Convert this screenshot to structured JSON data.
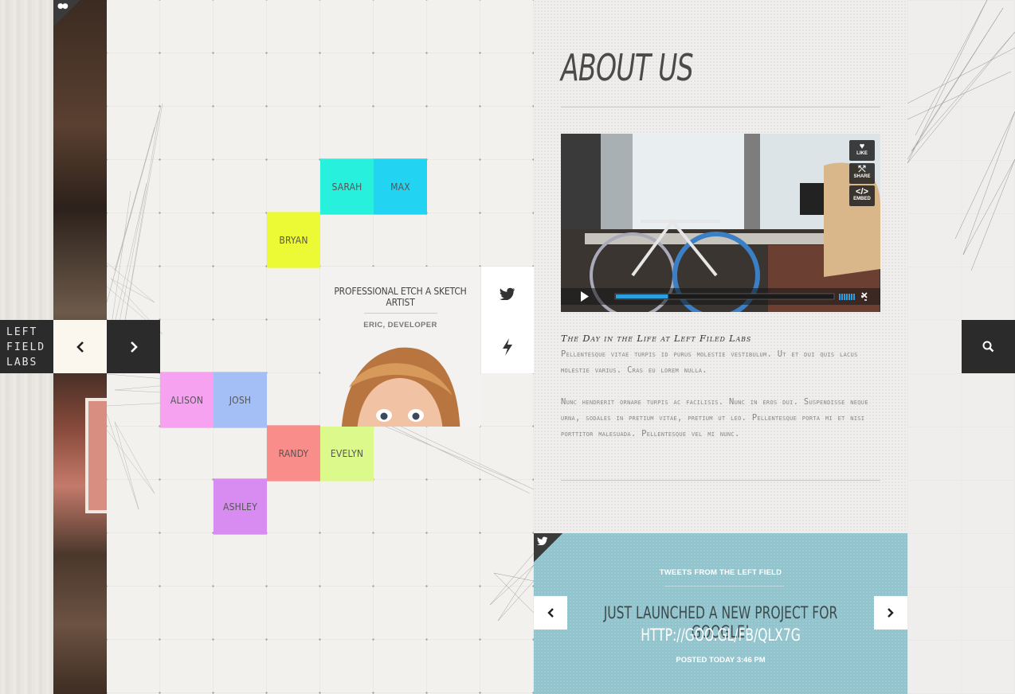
{
  "brand": {
    "lines": [
      "LEFT",
      "FIELD",
      "LABS"
    ]
  },
  "nav": {
    "prev_icon": "chevron-left-icon",
    "next_icon": "chevron-right-icon"
  },
  "team": [
    {
      "name": "SARAH",
      "color": "#27f0dd"
    },
    {
      "name": "MAX",
      "color": "#22d3f2"
    },
    {
      "name": "BRYAN",
      "color": "#ecfa36"
    },
    {
      "name": "ALISON",
      "color": "#f6a2f1"
    },
    {
      "name": "JOSH",
      "color": "#a4bff6"
    },
    {
      "name": "RANDY",
      "color": "#f98d8a"
    },
    {
      "name": "EVELYN",
      "color": "#dcfa8b"
    },
    {
      "name": "ASHLEY",
      "color": "#d88cf2"
    }
  ],
  "profile": {
    "title": "PROFESSIONAL ETCH A SKETCH ARTIST",
    "role": "ERIC, DEVELOPER"
  },
  "side_buttons": {
    "twitter_icon": "twitter-bird-icon",
    "bolt_icon": "lightning-icon"
  },
  "about": {
    "heading": "ABOUT US",
    "video_buttons": {
      "like": "LIKE",
      "share": "SHARE",
      "embed": "EMBED"
    },
    "post_title": "The Day in the Life at Left Filed Labs",
    "paragraph_1": "Pellentesque vitae turpis id purus molestie vestibulum. Ut et dui quis lacus molestie varius. Cras eu lorem nulla.",
    "paragraph_2": "Nunc hendrerit ornare turpis ac facilisis. Nunc in eros dui. Suspendisse neque urna, sodales in pretium vitae, pretium ut leo. Pellentesque porta mi et nisi porttitor malesuada. Pellentesque vel mi nunc."
  },
  "video": {
    "progress": 0.24
  },
  "tweets": {
    "label": "TWEETS FROM THE LEFT FIELD",
    "text": "JUST LAUNCHED A NEW PROJECT FOR GOOGLE!",
    "link": "HTTP://GOO.GL/FB/QLX7G",
    "time": "POSTED TODAY 3:46 PM"
  },
  "colors": {
    "dark": "#2b2b2b",
    "tweet_bg": "#92c4ce"
  }
}
